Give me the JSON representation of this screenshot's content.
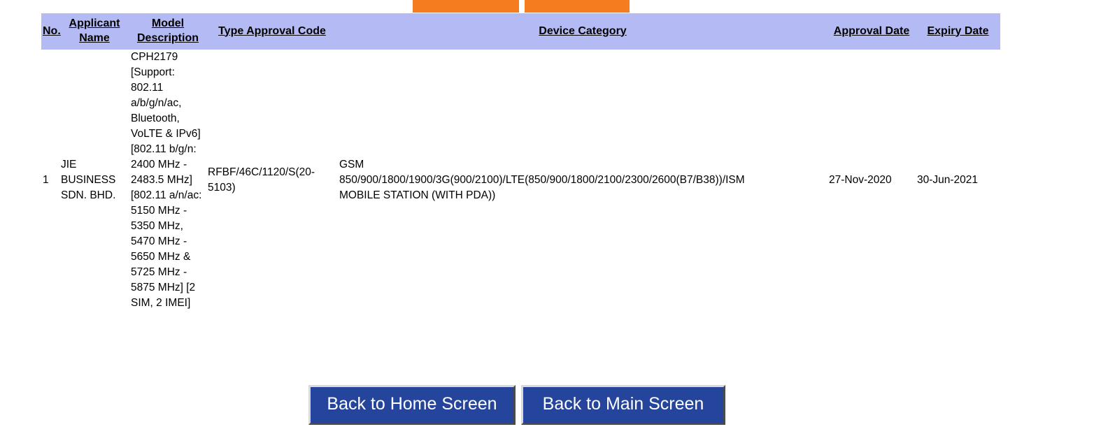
{
  "decorations": {
    "orange_bar_left": "orange-banner-segment",
    "orange_bar_right": "orange-banner-segment",
    "orange_color": "#f57d20",
    "header_row_color": "#b4bbf4",
    "button_color": "#25449b"
  },
  "table": {
    "headers": {
      "no": "No.",
      "applicant_name": "Applicant Name",
      "model_description": "Model Description",
      "type_approval_code": "Type Approval Code",
      "device_category": "Device Category",
      "approval_date": "Approval Date",
      "expiry_date": "Expiry Date"
    },
    "rows": [
      {
        "no": "1",
        "applicant_name": "JIE BUSINESS SDN. BHD.",
        "model_description": "CPH2179 [Support: 802.11 a/b/g/n/ac, Bluetooth, VoLTE & IPv6] [802.11 b/g/n: 2400 MHz - 2483.5 MHz] [802.11 a/n/ac: 5150 MHz - 5350 MHz, 5470 MHz - 5650 MHz & 5725 MHz - 5875 MHz] [2 SIM, 2 IMEI]",
        "type_approval_code": "RFBF/46C/1120/S(20-5103)",
        "device_category_line1": "GSM",
        "device_category_line2": "850/900/1800/1900/3G(900/2100)/LTE(850/900/1800/2100/2300/2600(B7/B38))/ISM",
        "device_category_line3": "MOBILE STATION (WITH PDA))",
        "approval_date": "27-Nov-2020",
        "expiry_date": "30-Jun-2021"
      }
    ]
  },
  "footer": {
    "back_home_label": "Back to Home Screen",
    "back_main_label": "Back to Main Screen"
  }
}
